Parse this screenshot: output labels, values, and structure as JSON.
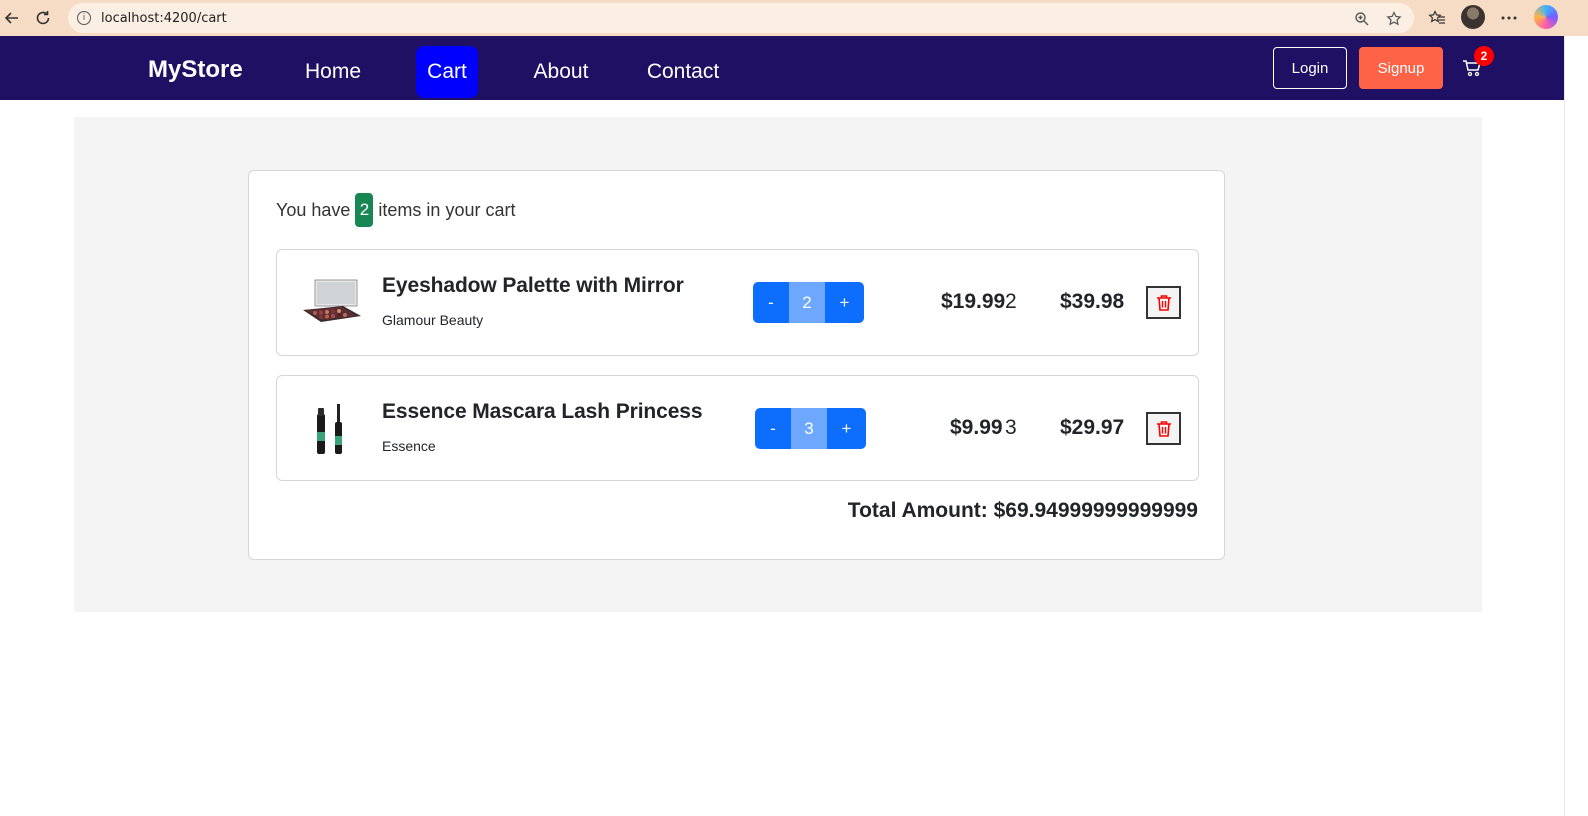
{
  "browser": {
    "url": "localhost:4200/cart"
  },
  "navbar": {
    "brand": "MyStore",
    "links": [
      {
        "label": "Home"
      },
      {
        "label": "Cart"
      },
      {
        "label": "About"
      },
      {
        "label": "Contact"
      }
    ],
    "login_label": "Login",
    "signup_label": "Signup",
    "cart_count": "2"
  },
  "cart": {
    "summary_prefix": "You have",
    "item_count": "2",
    "summary_suffix": "items in your cart",
    "items": [
      {
        "name": "Eyeshadow Palette with Mirror",
        "brand": "Glamour Beauty",
        "decrement": "-",
        "quantity": "2",
        "increment": "+",
        "unit_price": "$19.99",
        "unit_qty": "2",
        "line_total": "$39.98"
      },
      {
        "name": "Essence Mascara Lash Princess",
        "brand": "Essence",
        "decrement": "-",
        "quantity": "3",
        "increment": "+",
        "unit_price": "$9.99",
        "unit_qty": "3",
        "line_total": "$29.97"
      }
    ],
    "total_label": "Total Amount:",
    "total_value": "$69.94999999999999"
  },
  "colors": {
    "navbar": "#1f1064",
    "active_link": "#0000ff",
    "signup": "#ff6347",
    "qty_button": "#0d6efd",
    "count_badge": "#198754",
    "delete_icon": "#ff0000"
  }
}
